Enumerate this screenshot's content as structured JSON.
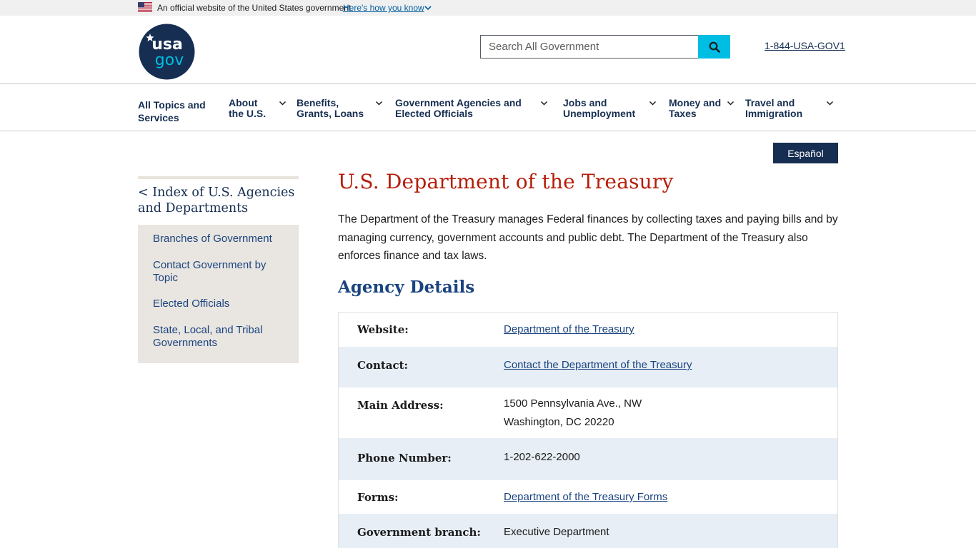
{
  "gov_banner": {
    "official_text": "An official website of the United States government",
    "how_you_know": "Here's how you know"
  },
  "header": {
    "logo_alt": "usa gov",
    "search_placeholder": "Search All Government",
    "phone": "1-844-USA-GOV1"
  },
  "nav": {
    "items": [
      {
        "label_line1": "All Topics and",
        "label_line2": "Services"
      },
      {
        "label_line1": "About",
        "label_line2": "the U.S."
      },
      {
        "label_line1": "Benefits,",
        "label_line2": "Grants, Loans"
      },
      {
        "label_line1": "Government Agencies and",
        "label_line2": "Elected Officials"
      },
      {
        "label_line1": "Jobs and",
        "label_line2": "Unemployment"
      },
      {
        "label_line1": "Money and",
        "label_line2": "Taxes"
      },
      {
        "label_line1": "Travel and",
        "label_line2": "Immigration"
      }
    ]
  },
  "language_button": "Español",
  "sidebar": {
    "title_line1": "< Index of U.S. Agencies",
    "title_line2": "and Departments",
    "links": [
      "Branches of Government",
      "Contact Government by Topic",
      "Elected Officials",
      "State, Local, and Tribal Governments"
    ]
  },
  "main": {
    "title": "U.S. Department of the Treasury",
    "intro": "The Department of the Treasury manages Federal finances by collecting taxes and paying bills and by managing currency, government accounts and public debt. The Department of the Treasury also enforces finance and tax laws.",
    "section_title": "Agency Details",
    "details": [
      {
        "label": "Website:",
        "value": "Department of the Treasury"
      },
      {
        "label": "Contact:",
        "value": "Contact the Department of the Treasury"
      },
      {
        "label": "Main Address:",
        "value_line1": "1500 Pennsylvania Ave., NW",
        "value_line2": "Washington, DC 20220"
      },
      {
        "label": "Phone Number:",
        "value": "1-202-622-2000"
      },
      {
        "label": "Forms:",
        "value": "Department of the Treasury Forms"
      },
      {
        "label": "Government branch:",
        "value": "Executive Department"
      }
    ]
  },
  "colors": {
    "title_red": "#b51d09",
    "navy": "#162e51",
    "link_blue": "#1a4480",
    "search_button": "#00bde3",
    "row_alt": "#e7eef5"
  }
}
